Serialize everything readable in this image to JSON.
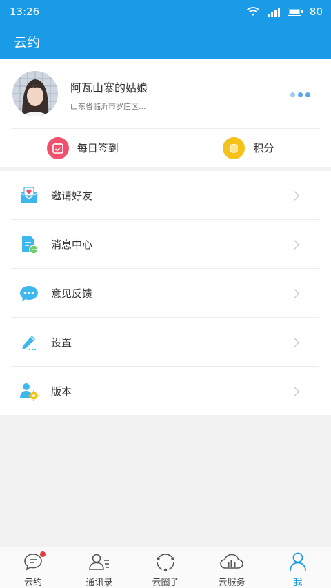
{
  "status_bar": {
    "time": "13:26",
    "battery": "80"
  },
  "app_bar": {
    "title": "云约"
  },
  "profile": {
    "name": "阿瓦山寨的姑娘",
    "location": "山东省临沂市罗庄区..."
  },
  "quick_actions": [
    {
      "label": "每日签到",
      "icon": "calendar-check-icon",
      "color": "#f0506e"
    },
    {
      "label": "积分",
      "icon": "coins-icon",
      "color": "#f5c21b"
    }
  ],
  "menu": [
    {
      "label": "邀请好友",
      "icon": "invite-envelope-icon"
    },
    {
      "label": "消息中心",
      "icon": "message-document-icon"
    },
    {
      "label": "意见反馈",
      "icon": "chat-bubble-icon"
    },
    {
      "label": "设置",
      "icon": "pencil-icon"
    },
    {
      "label": "版本",
      "icon": "user-gear-icon"
    }
  ],
  "tabs": [
    {
      "label": "云约",
      "icon": "chat-icon",
      "badge": true
    },
    {
      "label": "通讯录",
      "icon": "contacts-icon"
    },
    {
      "label": "云圈子",
      "icon": "circle-icon"
    },
    {
      "label": "云服务",
      "icon": "cloud-icon"
    },
    {
      "label": "我",
      "icon": "person-icon",
      "active": true
    }
  ],
  "colors": {
    "primary": "#1a9be8",
    "accent_red": "#f0506e",
    "accent_yellow": "#f5c21b",
    "icon_blue": "#3db8ef"
  }
}
